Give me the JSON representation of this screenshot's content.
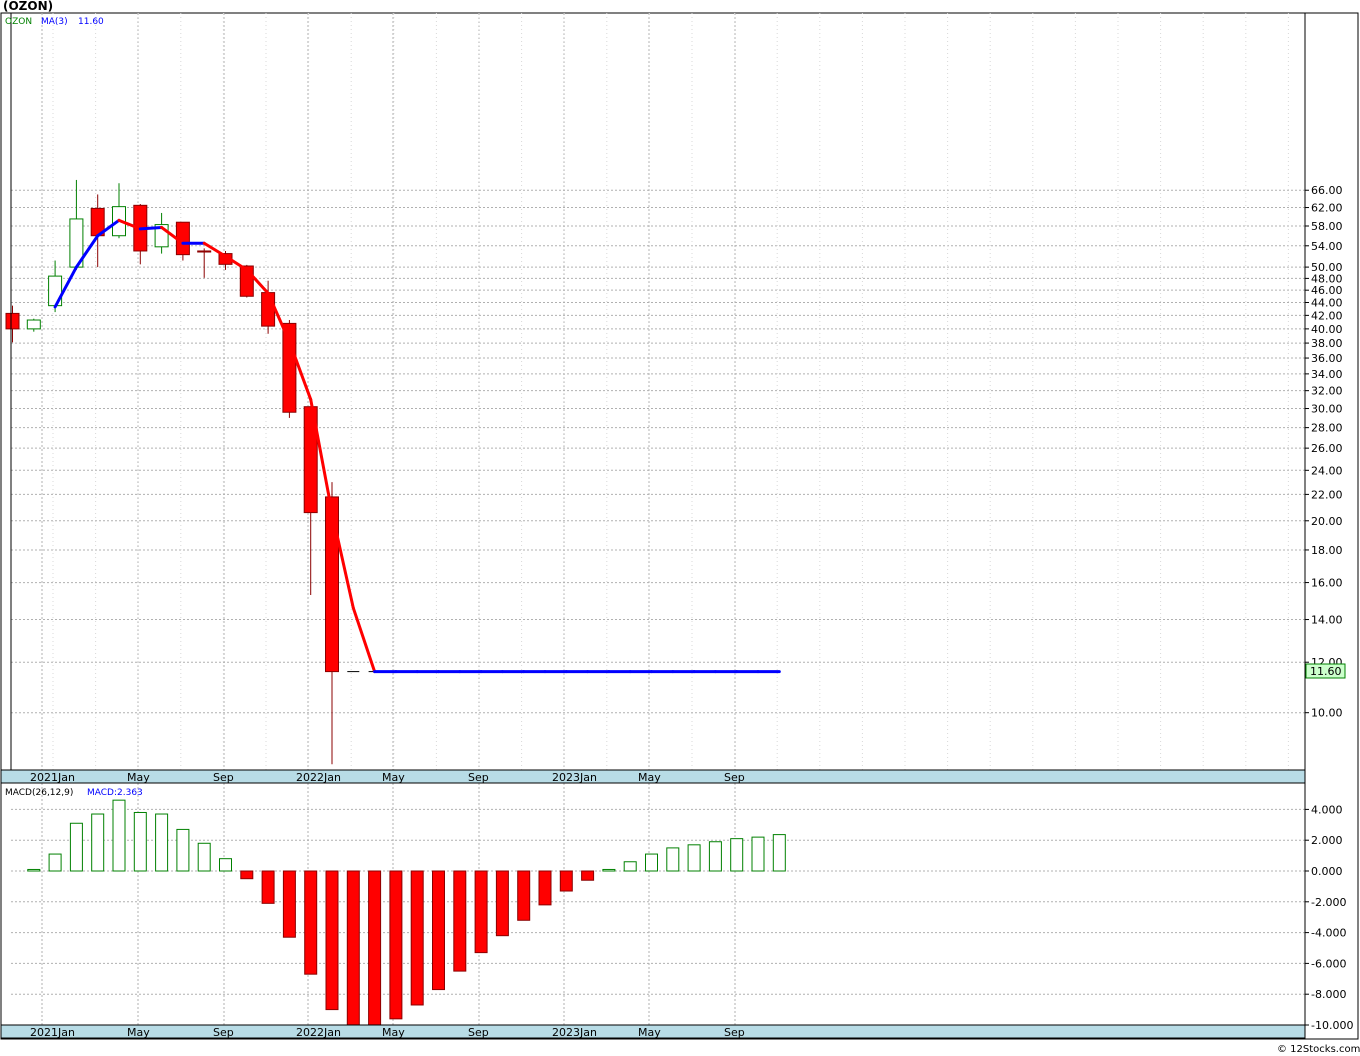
{
  "title": "(OZON)",
  "legend": {
    "symbol": "OZON",
    "ma_label": "MA(3)",
    "ma_value": "11.60",
    "macd_label": "MACD(26,12,9)",
    "macd_value": "MACD:2.363"
  },
  "last_price_tag": "11.60",
  "footer": "© 12Stocks.com",
  "x_axis_labels": [
    "2021Jan",
    "May",
    "Sep",
    "2022Jan",
    "May",
    "Sep",
    "2023Jan",
    "May",
    "Sep"
  ],
  "price_axis_ticks": [
    "66.00",
    "62.00",
    "58.00",
    "54.00",
    "50.00",
    "48.00",
    "46.00",
    "44.00",
    "42.00",
    "40.00",
    "38.00",
    "36.00",
    "34.00",
    "32.00",
    "30.00",
    "28.00",
    "26.00",
    "24.00",
    "22.00",
    "20.00",
    "18.00",
    "16.00",
    "14.00",
    "12.00",
    "10.00"
  ],
  "macd_axis_ticks": [
    "4.000",
    "2.000",
    "0.000",
    "-2.000",
    "-4.000",
    "-6.000",
    "-8.000",
    "-10.000"
  ],
  "colors": {
    "up": "#008000",
    "down": "#ff0000",
    "ma_up": "#0000ff",
    "ma_down": "#ff0000",
    "axis_band": "#b8dce6",
    "price_tag_bg": "#ccffcc",
    "grid": "#b0b0b0"
  },
  "chart_data": [
    {
      "type": "candlestick",
      "title": "(OZON)",
      "y_scale": "log",
      "ylim": [
        8.3,
        72
      ],
      "ohlc": [
        {
          "o": 42.3,
          "h": 43.5,
          "l": 38.1,
          "c": 40.0
        },
        {
          "o": 40.0,
          "h": 41.5,
          "l": 39.6,
          "c": 41.3
        },
        {
          "o": 43.5,
          "h": 51.2,
          "l": 42.5,
          "c": 48.4
        },
        {
          "o": 50.0,
          "h": 68.5,
          "l": 49.5,
          "c": 59.5
        },
        {
          "o": 61.8,
          "h": 65.0,
          "l": 50.0,
          "c": 56.0
        },
        {
          "o": 56.0,
          "h": 67.7,
          "l": 55.5,
          "c": 62.2
        },
        {
          "o": 62.5,
          "h": 62.8,
          "l": 50.5,
          "c": 53.0
        },
        {
          "o": 53.8,
          "h": 60.8,
          "l": 52.5,
          "c": 58.3
        },
        {
          "o": 58.8,
          "h": 58.8,
          "l": 51.2,
          "c": 52.3
        },
        {
          "o": 53.0,
          "h": 53.5,
          "l": 48.1,
          "c": 52.8
        },
        {
          "o": 52.5,
          "h": 53.0,
          "l": 49.5,
          "c": 50.5
        },
        {
          "o": 50.2,
          "h": 50.4,
          "l": 44.8,
          "c": 45.0
        },
        {
          "o": 45.6,
          "h": 47.6,
          "l": 39.3,
          "c": 40.4
        },
        {
          "o": 40.8,
          "h": 41.3,
          "l": 29.0,
          "c": 29.6
        },
        {
          "o": 30.2,
          "h": 30.2,
          "l": 15.3,
          "c": 20.6
        },
        {
          "o": 21.8,
          "h": 23.0,
          "l": 8.3,
          "c": 11.6
        },
        {
          "o": 11.6,
          "h": 11.6,
          "l": 11.6,
          "c": 11.6
        },
        {
          "o": 11.6,
          "h": 11.6,
          "l": 11.6,
          "c": 11.6
        }
      ],
      "ma": [
        null,
        null,
        43.3,
        50.0,
        56.0,
        59.2,
        57.4,
        57.7,
        54.5,
        54.5,
        52.0,
        49.5,
        45.5,
        38.2,
        31.0,
        20.6,
        14.6,
        11.6,
        11.6,
        11.6,
        11.6,
        11.6,
        11.6,
        11.6,
        11.6,
        11.6,
        11.6,
        11.6,
        11.6,
        11.6,
        11.6,
        11.6,
        11.6,
        11.6,
        11.6,
        11.6,
        11.6
      ],
      "series": [
        {
          "name": "MA(3)",
          "values": "ma"
        }
      ]
    },
    {
      "type": "bar",
      "title": "MACD(26,12,9)",
      "ylim": [
        -10,
        5
      ],
      "series": [
        {
          "name": "MACD:2.363",
          "values": [
            0.1,
            1.1,
            3.1,
            3.7,
            4.6,
            3.8,
            3.7,
            2.7,
            1.8,
            0.8,
            -0.5,
            -2.1,
            -4.3,
            -6.7,
            -9.0,
            -10.0,
            -10.0,
            -9.6,
            -8.7,
            -7.7,
            -6.5,
            -5.3,
            -4.2,
            -3.2,
            -2.2,
            -1.3,
            -0.6,
            0.1,
            0.6,
            1.1,
            1.5,
            1.7,
            1.9,
            2.1,
            2.2,
            2.363
          ]
        }
      ]
    }
  ]
}
